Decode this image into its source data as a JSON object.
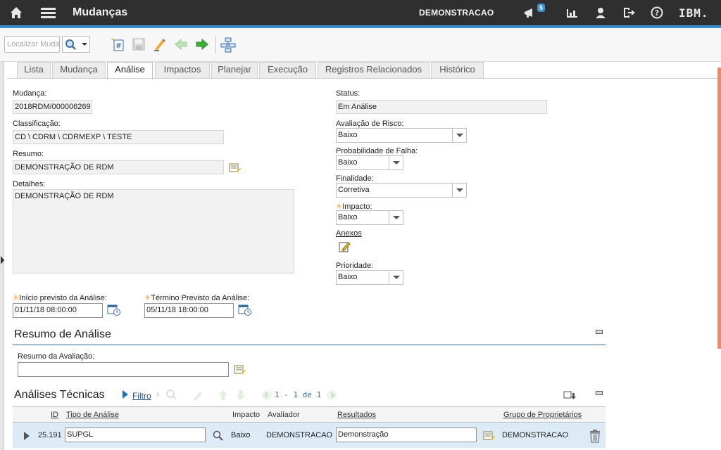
{
  "header": {
    "app_title": "Mudanças",
    "user": "DEMONSTRACAO",
    "notification_count": "5",
    "logo": "IBM.",
    "icons": [
      "home-icon",
      "menu-icon",
      "megaphone-icon",
      "chart-icon",
      "profile-icon",
      "logout-icon",
      "help-icon"
    ]
  },
  "toolbar": {
    "search_placeholder": "Localizar Mudança",
    "tools": [
      "new-record-icon",
      "save-icon",
      "clear-changes-icon",
      "previous-record-icon",
      "next-record-icon",
      "workflow-icon"
    ]
  },
  "tabs": [
    {
      "label": "Lista"
    },
    {
      "label": "Mudança"
    },
    {
      "label": "Análise",
      "active": true
    },
    {
      "label": "Impactos"
    },
    {
      "label": "Planejar"
    },
    {
      "label": "Execução"
    },
    {
      "label": "Registros Relacionados"
    },
    {
      "label": "Histórico"
    }
  ],
  "form": {
    "mudanca_label": "Mudança:",
    "mudanca_value": "2018RDM/000006269",
    "classificacao_label": "Classificação:",
    "classificacao_value": "CD \\ CDRM \\ CDRMEXP \\ TESTE",
    "resumo_label": "Resumo:",
    "resumo_value": "DEMONSTRAÇÃO DE RDM",
    "detalhes_label": "Detalhes:",
    "detalhes_value": "DEMONSTRAÇÃO DE RDM",
    "inicio_label": "Início previsto da Análise:",
    "inicio_value": "01/11/18 08:00:00",
    "termino_label": "Término Previsto da Análise:",
    "termino_value": "05/11/18 18:00:00",
    "status_label": "Status:",
    "status_value": "Em Análise",
    "risco_label": "Avaliação de Risco:",
    "risco_value": "Baixo",
    "falha_label": "Probabilidade de Falha:",
    "falha_value": "Baixo",
    "finalidade_label": "Finalidade:",
    "finalidade_value": "Corretiva",
    "impacto_label": "Impacto:",
    "impacto_value": "Baixo",
    "anexos_label": "Anexos",
    "prioridade_label": "Prioridade:",
    "prioridade_value": "Baixo",
    "required_marker": "✳"
  },
  "resumo_analise": {
    "title": "Resumo de Análise",
    "avaliacao_label": "Resumo da Avaliação:",
    "avaliacao_value": ""
  },
  "analises_tecnicas": {
    "title": "Análises Técnicas",
    "filter_label": "Filtro",
    "pager": "1 - 1 de 1",
    "columns": [
      "ID",
      "Tipo de Análise",
      "Impacto",
      "Avaliador",
      "Resultados",
      "Grupo de Proprietários"
    ],
    "rows": [
      {
        "id": "25.191",
        "tipo": "SUPGL",
        "impacto": "Baixo",
        "avaliador": "DEMONSTRACAO",
        "resultados": "Demonstração",
        "grupo": "DEMONSTRACAO"
      }
    ]
  },
  "colors": {
    "topbar": "#2f2f2f",
    "accent": "#3b8fd1",
    "required": "#f3a12a",
    "row_highlight": "#dcebf6"
  }
}
